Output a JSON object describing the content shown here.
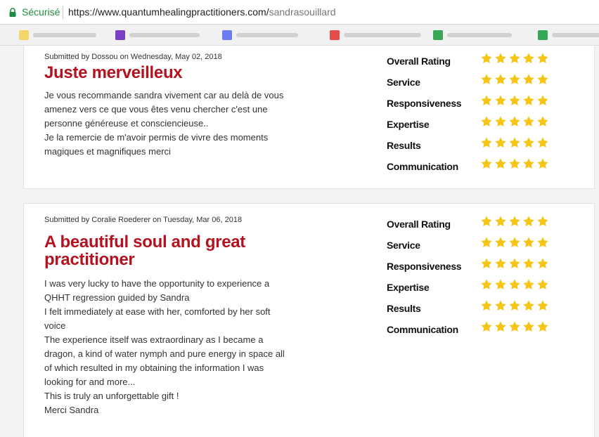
{
  "browser": {
    "secure_label": "Sécurisé",
    "url_base": "https://www.quantumhealingpractitioners.com/",
    "url_path": "sandrasouillard"
  },
  "bookmarks": [
    {
      "color": "#f4d56a",
      "icon": "folder-icon"
    },
    {
      "color": "#7b3fc4",
      "icon": "bookmark-icon"
    },
    {
      "color": "#6a7cf0",
      "icon": "bookmark-icon"
    },
    {
      "color": "#e24c4c",
      "icon": "bookmark-icon"
    },
    {
      "color": "#3aa757",
      "icon": "bookmark-icon"
    },
    {
      "color": "#34a853",
      "icon": "bookmark-icon"
    }
  ],
  "colors": {
    "title": "#b3121e",
    "star": "#f5c518"
  },
  "reviews": [
    {
      "meta": "Submitted by Dossou on Wednesday, May 02, 2018",
      "title": "Juste merveilleux",
      "body_lines": [
        "Je vous recommande sandra vivement car au delà de vous",
        "amenez vers ce que vous êtes venu chercher c'est une",
        "personne généreuse et consciencieuse..",
        "Je la remercie de m'avoir permis de vivre des moments",
        "magiques et magnifiques merci"
      ],
      "ratings": [
        {
          "label": "Overall Rating",
          "stars": 5
        },
        {
          "label": "Service",
          "stars": 5
        },
        {
          "label": "Responsiveness",
          "stars": 5
        },
        {
          "label": "Expertise",
          "stars": 5
        },
        {
          "label": "Results",
          "stars": 5
        },
        {
          "label": "Communication",
          "stars": 5
        }
      ]
    },
    {
      "meta": "Submitted by Coralie Roederer on Tuesday, Mar 06, 2018",
      "title": "A beautiful soul and great practitioner",
      "body_lines": [
        "I was very lucky to have the opportunity to experience a",
        "QHHT regression guided by Sandra",
        "I felt immediately at ease with her, comforted by her soft",
        "voice",
        "The experience itself was extraordinary as I became a",
        "dragon, a kind of water nymph and pure energy in space all",
        "of which resulted in my obtaining the information I was",
        "looking for and more...",
        "This is truly an unforgettable gift !",
        "Merci Sandra"
      ],
      "ratings": [
        {
          "label": "Overall Rating",
          "stars": 5
        },
        {
          "label": "Service",
          "stars": 5
        },
        {
          "label": "Responsiveness",
          "stars": 5
        },
        {
          "label": "Expertise",
          "stars": 5
        },
        {
          "label": "Results",
          "stars": 5
        },
        {
          "label": "Communication",
          "stars": 5
        }
      ]
    }
  ]
}
